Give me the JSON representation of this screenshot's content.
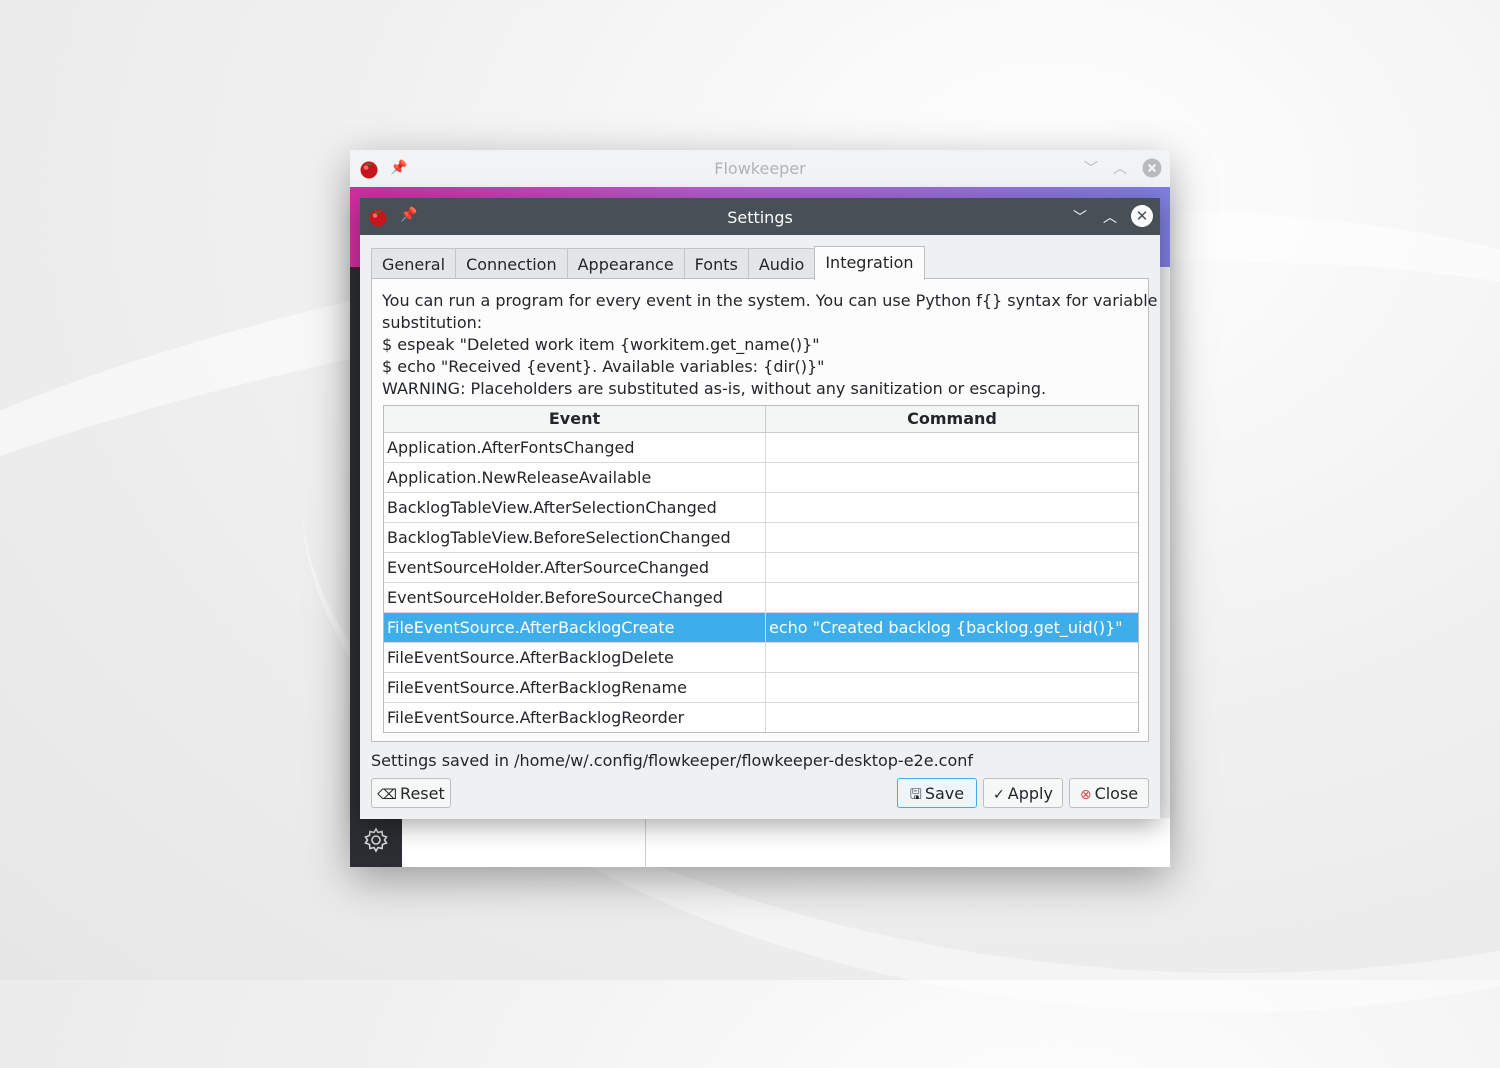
{
  "main_window": {
    "title": "Flowkeeper"
  },
  "settings": {
    "title": "Settings",
    "tabs": [
      {
        "label": "General"
      },
      {
        "label": "Connection"
      },
      {
        "label": "Appearance"
      },
      {
        "label": "Fonts"
      },
      {
        "label": "Audio"
      },
      {
        "label": "Integration",
        "active": true
      }
    ],
    "help_lines": [
      "You can run a program for every event in the system. You can use Python f{} syntax for variable",
      "substitution:",
      "$ espeak \"Deleted work item {workitem.get_name()}\"",
      "$ echo \"Received {event}. Available variables: {dir()}\"",
      "WARNING: Placeholders are substituted as-is, without any sanitization or escaping."
    ],
    "table": {
      "headers": {
        "event": "Event",
        "command": "Command"
      },
      "rows": [
        {
          "event": "Application.AfterFontsChanged",
          "command": ""
        },
        {
          "event": "Application.NewReleaseAvailable",
          "command": ""
        },
        {
          "event": "BacklogTableView.AfterSelectionChanged",
          "command": ""
        },
        {
          "event": "BacklogTableView.BeforeSelectionChanged",
          "command": ""
        },
        {
          "event": "EventSourceHolder.AfterSourceChanged",
          "command": ""
        },
        {
          "event": "EventSourceHolder.BeforeSourceChanged",
          "command": ""
        },
        {
          "event": "FileEventSource.AfterBacklogCreate",
          "command": "echo \"Created backlog {backlog.get_uid()}\"",
          "selected": true
        },
        {
          "event": "FileEventSource.AfterBacklogDelete",
          "command": ""
        },
        {
          "event": "FileEventSource.AfterBacklogRename",
          "command": ""
        },
        {
          "event": "FileEventSource.AfterBacklogReorder",
          "command": ""
        }
      ]
    },
    "status": "Settings saved in /home/w/.config/flowkeeper/flowkeeper-desktop-e2e.conf",
    "buttons": {
      "reset": "Reset",
      "save": "Save",
      "apply": "Apply",
      "close": "Close"
    },
    "colors": {
      "accent": "#3daee9",
      "titlebar": "#475057"
    }
  }
}
